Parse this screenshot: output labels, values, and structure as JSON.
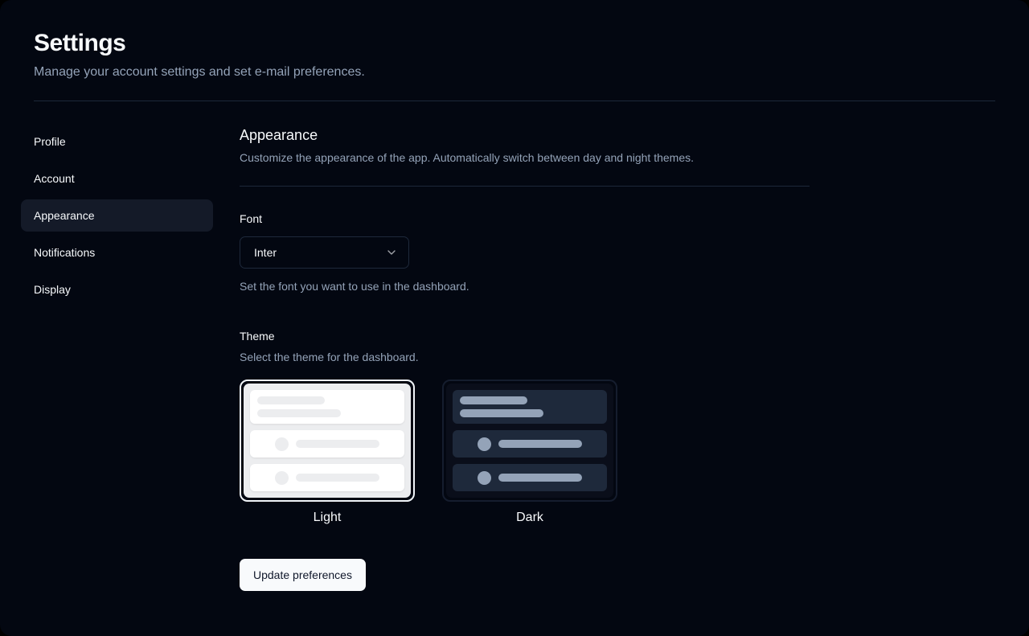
{
  "page": {
    "title": "Settings",
    "subtitle": "Manage your account settings and set e-mail preferences."
  },
  "sidebar": {
    "items": [
      {
        "label": "Profile",
        "active": false
      },
      {
        "label": "Account",
        "active": false
      },
      {
        "label": "Appearance",
        "active": true
      },
      {
        "label": "Notifications",
        "active": false
      },
      {
        "label": "Display",
        "active": false
      }
    ]
  },
  "section": {
    "title": "Appearance",
    "description": "Customize the appearance of the app. Automatically switch between day and night themes."
  },
  "font_field": {
    "label": "Font",
    "selected_value": "Inter",
    "help": "Set the font you want to use in the dashboard."
  },
  "theme_field": {
    "label": "Theme",
    "help": "Select the theme for the dashboard.",
    "options": [
      {
        "label": "Light",
        "selected": true
      },
      {
        "label": "Dark",
        "selected": false
      }
    ]
  },
  "actions": {
    "submit_label": "Update preferences"
  },
  "colors": {
    "page_background": "#030711",
    "foreground": "#f8fafc",
    "muted_foreground": "#94a3b8",
    "border": "#1e293b",
    "divider": "#1d283a",
    "sidebar_active_bg": "#141a28",
    "selected_ring": "#f1f5f9",
    "light_preview_panel": "#ecedef",
    "light_preview_row": "#ffffff",
    "dark_preview_row": "#1e293b",
    "dark_preview_skeleton": "#94a3b8",
    "button_bg": "#f8fafc",
    "button_text": "#0f172a"
  }
}
